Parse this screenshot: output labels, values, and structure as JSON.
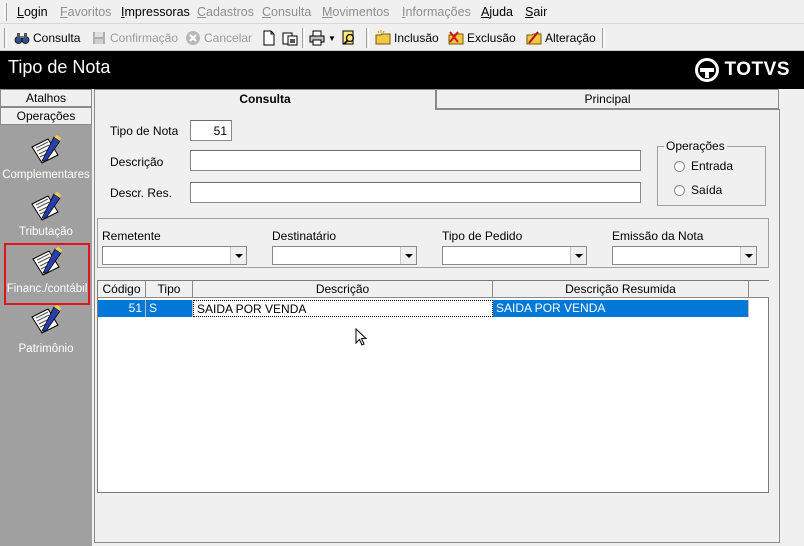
{
  "menu": {
    "items": [
      {
        "label": "Login",
        "disabled": false
      },
      {
        "label": "Favoritos",
        "disabled": true
      },
      {
        "label": "Impressoras",
        "disabled": false
      },
      {
        "label": "Cadastros",
        "disabled": true
      },
      {
        "label": "Consulta",
        "disabled": true
      },
      {
        "label": "Movimentos",
        "disabled": true
      },
      {
        "label": "Informações",
        "disabled": true
      },
      {
        "label": "Ajuda",
        "disabled": false
      },
      {
        "label": "Sair",
        "disabled": false
      }
    ]
  },
  "toolbar": {
    "consulta": "Consulta",
    "confirmacao": "Confirmação",
    "cancelar": "Cancelar",
    "inclusao": "Inclusão",
    "exclusao": "Exclusão",
    "alteracao": "Alteração"
  },
  "header": {
    "title": "Tipo de Nota",
    "logo": "TOTVS"
  },
  "sidebar": {
    "tab_atalhos": "Atalhos",
    "tab_operacoes": "Operações",
    "items": [
      {
        "label": "Complementares"
      },
      {
        "label": "Tributação"
      },
      {
        "label": "Financ./contábil"
      },
      {
        "label": "Patrimônio"
      }
    ]
  },
  "tabs": {
    "consulta": "Consulta",
    "principal": "Principal"
  },
  "form": {
    "tipo_label": "Tipo de Nota",
    "tipo_value": "51",
    "descricao_label": "Descrição",
    "descricao_value": "",
    "descr_res_label": "Descr. Res.",
    "descr_res_value": "",
    "operacoes_title": "Operações",
    "radio_entrada": "Entrada",
    "radio_saida": "Saída"
  },
  "filters": {
    "remetente": "Remetente",
    "destinatario": "Destinatário",
    "tipo_pedido": "Tipo de Pedido",
    "emissao": "Emissão da Nota"
  },
  "grid": {
    "headers": [
      "Código",
      "Tipo",
      "Descrição",
      "Descrição Resumida"
    ],
    "rows": [
      {
        "codigo": "51",
        "tipo": "S",
        "descricao": "SAIDA POR VENDA",
        "resumida": "SAIDA POR VENDA"
      }
    ]
  },
  "colors": {
    "header_bg": "#000000",
    "sidebar_bg": "#a0a0a0",
    "selection": "#0078d7",
    "highlight": "#e0141e"
  }
}
